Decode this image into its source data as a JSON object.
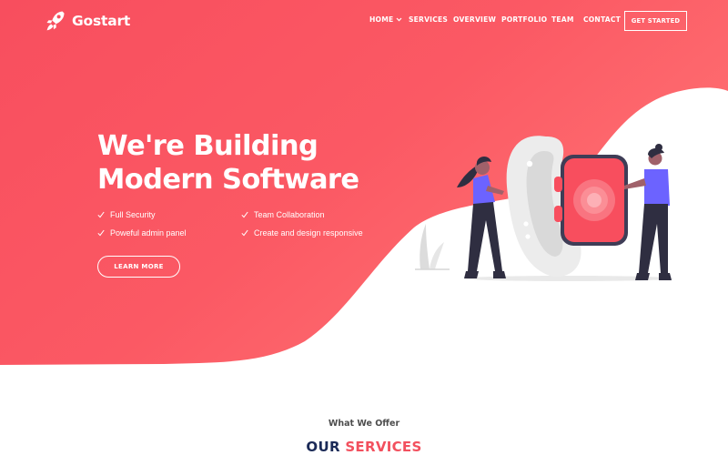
{
  "brand": {
    "name": "Gostart",
    "logo_icon": "rocket-icon"
  },
  "nav": {
    "items": [
      {
        "label": "HOME",
        "has_dropdown": true
      },
      {
        "label": "SERVICES"
      },
      {
        "label": "OVERVIEW"
      },
      {
        "label": "PORTFOLIO"
      },
      {
        "label": "TEAM"
      },
      {
        "label": "CONTACT"
      }
    ],
    "cta_label": "GET STARTED"
  },
  "hero": {
    "title_line1": "We're Building",
    "title_line2": "Modern Software",
    "features": [
      "Full Security",
      "Team Collaboration",
      "Poweful admin panel",
      "Create and design responsive"
    ],
    "feature_icon": "check-icon",
    "button_label": "LEARN MORE",
    "illustration": "smartwatch-illustration"
  },
  "services": {
    "subtitle": "What We Offer",
    "title_part1": "OUR",
    "title_part2": "SERVICES"
  },
  "colors": {
    "primary": "#f2505e",
    "gradient_light": "#ff6b6b",
    "navy": "#1b2a57",
    "white": "#ffffff"
  }
}
